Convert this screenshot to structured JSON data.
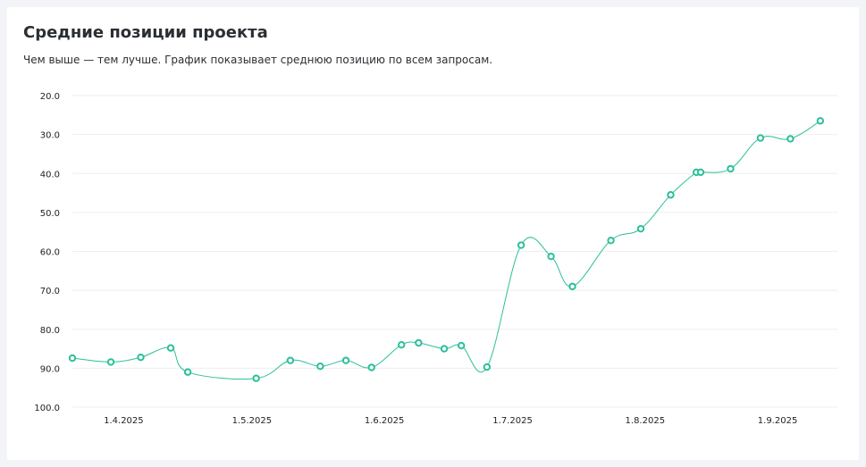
{
  "header": {
    "title": "Средние позиции проекта",
    "subtitle": "Чем выше — тем лучше. График показывает среднюю позицию по всем запросам."
  },
  "chart_data": {
    "type": "line",
    "title": "",
    "xlabel": "",
    "ylabel": "",
    "y_inverted": true,
    "ylim": [
      20,
      100
    ],
    "yticks": [
      "20.0",
      "30.0",
      "40.0",
      "50.0",
      "60.0",
      "70.0",
      "80.0",
      "90.0",
      "100.0"
    ],
    "xlim": [
      "2025-03-20",
      "2025-09-15"
    ],
    "xticks": [
      {
        "date": "2025-04-01",
        "label": "1.4.2025"
      },
      {
        "date": "2025-05-01",
        "label": "1.5.2025"
      },
      {
        "date": "2025-06-01",
        "label": "1.6.2025"
      },
      {
        "date": "2025-07-01",
        "label": "1.7.2025"
      },
      {
        "date": "2025-08-01",
        "label": "1.8.2025"
      },
      {
        "date": "2025-09-01",
        "label": "1.9.2025"
      }
    ],
    "grid": true,
    "color": "#2bbf9a",
    "series": [
      {
        "name": "",
        "points": [
          {
            "x": "2025-03-20",
            "y": 87.4
          },
          {
            "x": "2025-03-29",
            "y": 88.4
          },
          {
            "x": "2025-04-05",
            "y": 87.2
          },
          {
            "x": "2025-04-12",
            "y": 84.8
          },
          {
            "x": "2025-04-16",
            "y": 91.0
          },
          {
            "x": "2025-05-02",
            "y": 92.6
          },
          {
            "x": "2025-05-10",
            "y": 88.0
          },
          {
            "x": "2025-05-17",
            "y": 89.5
          },
          {
            "x": "2025-05-23",
            "y": 88.0
          },
          {
            "x": "2025-05-29",
            "y": 89.8
          },
          {
            "x": "2025-06-05",
            "y": 84.0
          },
          {
            "x": "2025-06-09",
            "y": 83.5
          },
          {
            "x": "2025-06-15",
            "y": 85.0
          },
          {
            "x": "2025-06-19",
            "y": 84.2
          },
          {
            "x": "2025-06-25",
            "y": 89.7
          },
          {
            "x": "2025-07-03",
            "y": 58.4
          },
          {
            "x": "2025-07-10",
            "y": 61.3
          },
          {
            "x": "2025-07-15",
            "y": 69.0
          },
          {
            "x": "2025-07-24",
            "y": 57.2
          },
          {
            "x": "2025-07-31",
            "y": 54.2
          },
          {
            "x": "2025-08-07",
            "y": 45.5
          },
          {
            "x": "2025-08-13",
            "y": 39.7
          },
          {
            "x": "2025-08-14",
            "y": 39.7
          },
          {
            "x": "2025-08-21",
            "y": 38.8
          },
          {
            "x": "2025-08-28",
            "y": 30.9
          },
          {
            "x": "2025-09-04",
            "y": 31.1
          },
          {
            "x": "2025-09-11",
            "y": 26.5
          }
        ]
      }
    ]
  }
}
